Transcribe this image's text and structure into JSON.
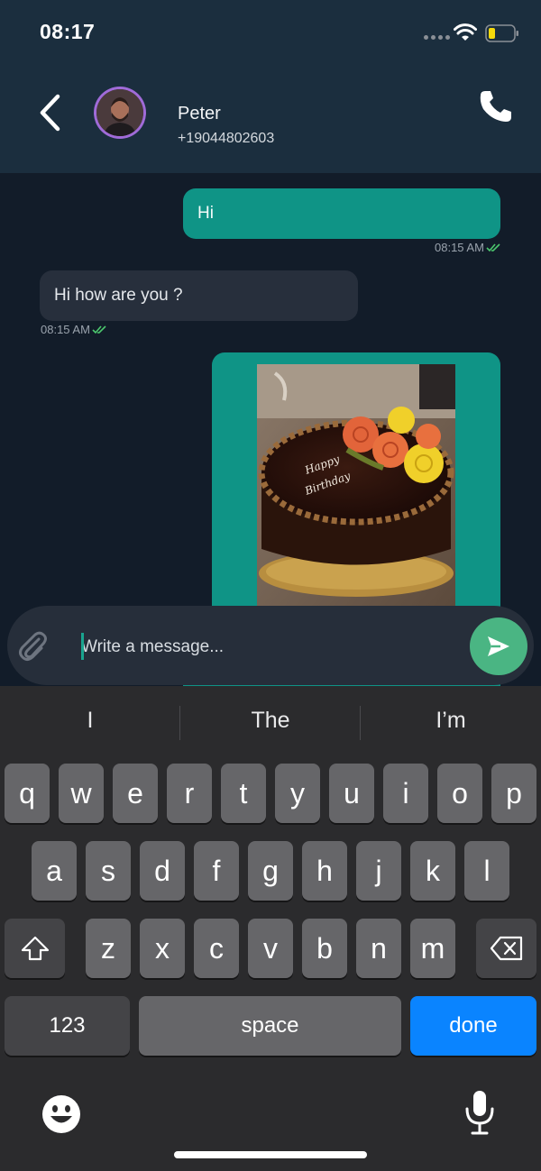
{
  "status_bar": {
    "time": "08:17"
  },
  "header": {
    "contact_name": "Peter",
    "contact_phone": "+19044802603"
  },
  "messages": [
    {
      "direction": "out",
      "text": "Hi",
      "time": "08:15 AM"
    },
    {
      "direction": "in",
      "text": "Hi how are you ?",
      "time": "08:15 AM"
    },
    {
      "direction": "out",
      "type": "image",
      "caption_in_image": "Happy Birthday"
    }
  ],
  "composer": {
    "placeholder": "Write a message..."
  },
  "keyboard": {
    "suggestions": [
      "I",
      "The",
      "I’m"
    ],
    "row1": [
      "q",
      "w",
      "e",
      "r",
      "t",
      "y",
      "u",
      "i",
      "o",
      "p"
    ],
    "row2": [
      "a",
      "s",
      "d",
      "f",
      "g",
      "h",
      "j",
      "k",
      "l"
    ],
    "row3": [
      "z",
      "x",
      "c",
      "v",
      "b",
      "n",
      "m"
    ],
    "numbers_label": "123",
    "space_label": "space",
    "done_label": "done"
  },
  "colors": {
    "accent": "#0f9486",
    "send": "#4ab583",
    "header_bg": "#1b2e3e",
    "chat_bg": "#121c29",
    "done_key": "#0a84ff"
  }
}
